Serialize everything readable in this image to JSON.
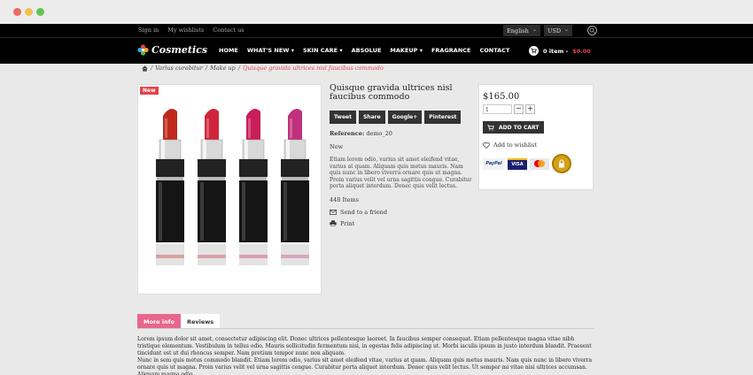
{
  "topbar": {
    "links": [
      "Sign in",
      "My wishlists",
      "Contact us"
    ],
    "language": "English",
    "currency": "USD"
  },
  "brand": {
    "name": "Cosmetics"
  },
  "menu": [
    "HOME",
    "WHAT'S NEW",
    "SKIN CARE",
    "ABSOLUE",
    "MAKEUP",
    "FRAGRANCE",
    "CONTACT"
  ],
  "cart": {
    "label": "0 item -",
    "total": "$0.00"
  },
  "breadcrumb": {
    "sep": "/",
    "items": [
      "Varius curabitur",
      "Make up"
    ],
    "current": "Quisque gravida ultrices nisl faucibus commodo"
  },
  "product": {
    "badge": "New",
    "title": "Quisque gravida ultrices nisl faucibus commodo",
    "share": [
      "Tweet",
      "Share",
      "Google+",
      "Pinterest"
    ],
    "reference_label": "Reference:",
    "reference": "demo_20",
    "condition": "New",
    "description": "Etiam lorem odio, varius sit amet eleifend vitae, varius at quam. Aliquam quis metus mauris. Nam quis nunc in libero viverra ornare quis ut magna. Proin varius velit vel urna sagittis congue. Curabitur porta aliquet interdum. Donec quis velit lectus.",
    "stock": "448 Items",
    "send_friend": "Send to a friend",
    "print": "Print",
    "lipstick_colors": [
      "#c0281c",
      "#d0243c",
      "#c81e5a",
      "#c0307c"
    ]
  },
  "buybox": {
    "price": "$165.00",
    "qty": "1",
    "add_to_cart": "ADD TO CART",
    "wishlist": "Add to wishlist",
    "payments": [
      "PayPal",
      "VISA"
    ]
  },
  "tabs": [
    "More info",
    "Reviews"
  ],
  "more_info": {
    "p1": "Lorem ipsum dolor sit amet, consectetur adipiscing elit. Donec ultrices pellentesque laoreet. In faucibus semper consequat. Etiam pellentesque magna vitae nibh tristique elementum. Vestibulum in tellus odio. Mauris sollicitudin fermentum nisi, in egestas felis adipiscing ut. Morbi iaculis ipsum in justo interdum blandit. Praesent tincidunt est ut dui rhoncus semper. Nam pretium tempor nunc non aliquam.",
    "p2": "Nunc in sem quis metus commodo blandit. Etiam lorem odio, varius sit amet eleifend vitae, varius at quam. Aliquam quis metus mauris. Nam quis nunc in libero viverra ornare quis ut magna. Proin varius velit vel urna sagittis congue. Curabitur porta aliquet interdum. Donec quis velit lectus. Ut semper mi vitae nisi ultrices accumsan. Aliquam magna odio,"
  }
}
